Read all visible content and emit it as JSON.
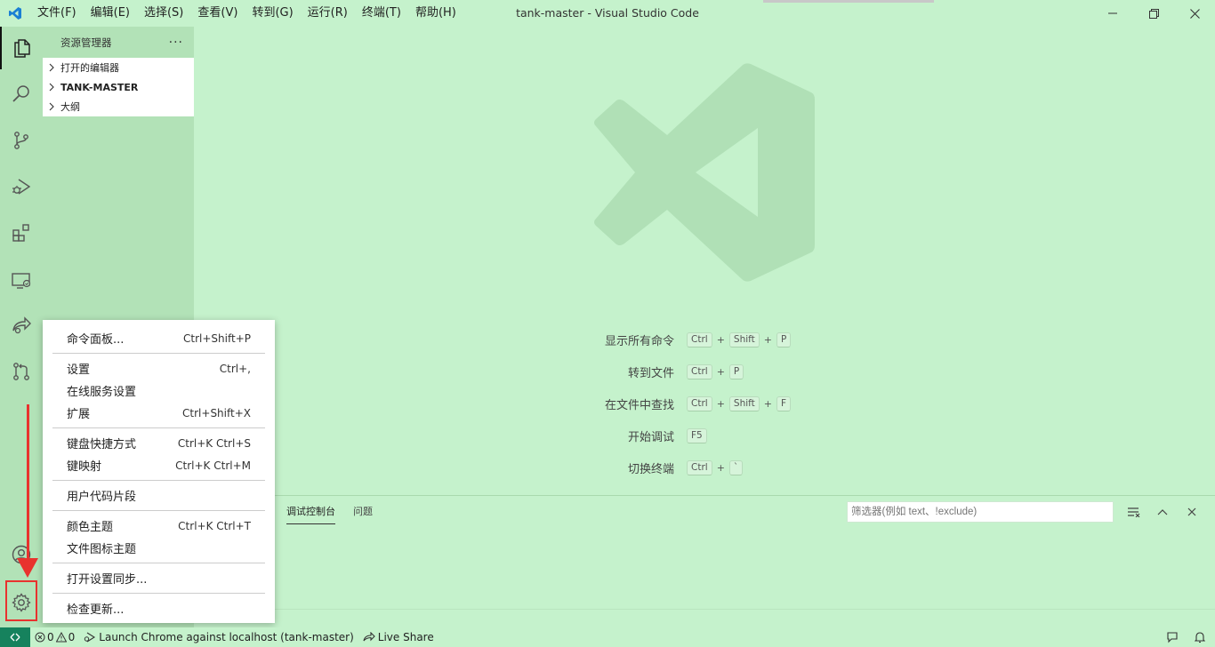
{
  "titlebar": {
    "menus": [
      "文件(F)",
      "编辑(E)",
      "选择(S)",
      "查看(V)",
      "转到(G)",
      "运行(R)",
      "终端(T)",
      "帮助(H)"
    ],
    "window_title": "tank-master - Visual Studio Code"
  },
  "activitybar": {
    "icons": [
      "files-icon",
      "search-icon",
      "source-control-icon",
      "run-debug-icon",
      "extensions-icon",
      "remote-explorer-icon",
      "live-share-icon",
      "pull-requests-icon",
      "accounts-icon",
      "gear-icon"
    ]
  },
  "sidebar": {
    "title": "资源管理器",
    "more": "···",
    "sections": [
      "打开的编辑器",
      "TANK-MASTER",
      "大纲"
    ]
  },
  "shortcuts": [
    {
      "label": "显示所有命令",
      "keys": [
        "Ctrl",
        "Shift",
        "P"
      ]
    },
    {
      "label": "转到文件",
      "keys": [
        "Ctrl",
        "P"
      ]
    },
    {
      "label": "在文件中查找",
      "keys": [
        "Ctrl",
        "Shift",
        "F"
      ]
    },
    {
      "label": "开始调试",
      "keys": [
        "F5"
      ]
    },
    {
      "label": "切换终端",
      "keys": [
        "Ctrl",
        "`"
      ]
    }
  ],
  "panel": {
    "tabs": [
      "调试控制台",
      "问题"
    ],
    "filter_placeholder": "筛选器(例如 text、!exclude)"
  },
  "context_menu": {
    "groups": [
      [
        {
          "label": "命令面板...",
          "shortcut": "Ctrl+Shift+P"
        }
      ],
      [
        {
          "label": "设置",
          "shortcut": "Ctrl+,"
        },
        {
          "label": "在线服务设置",
          "shortcut": ""
        },
        {
          "label": "扩展",
          "shortcut": "Ctrl+Shift+X"
        }
      ],
      [
        {
          "label": "键盘快捷方式",
          "shortcut": "Ctrl+K Ctrl+S"
        },
        {
          "label": "键映射",
          "shortcut": "Ctrl+K Ctrl+M"
        }
      ],
      [
        {
          "label": "用户代码片段",
          "shortcut": ""
        }
      ],
      [
        {
          "label": "颜色主题",
          "shortcut": "Ctrl+K Ctrl+T"
        },
        {
          "label": "文件图标主题",
          "shortcut": ""
        }
      ],
      [
        {
          "label": "打开设置同步...",
          "shortcut": ""
        }
      ],
      [
        {
          "label": "检查更新...",
          "shortcut": ""
        }
      ]
    ]
  },
  "statusbar": {
    "errors": "0",
    "warnings": "0",
    "launch": "Launch Chrome against localhost (tank-master)",
    "live_share": "Live Share"
  },
  "colors": {
    "background": "#c5f2cc",
    "sidebar": "#b2e2b7",
    "remote_indicator": "#16825d",
    "annotation": "#e8322e"
  }
}
